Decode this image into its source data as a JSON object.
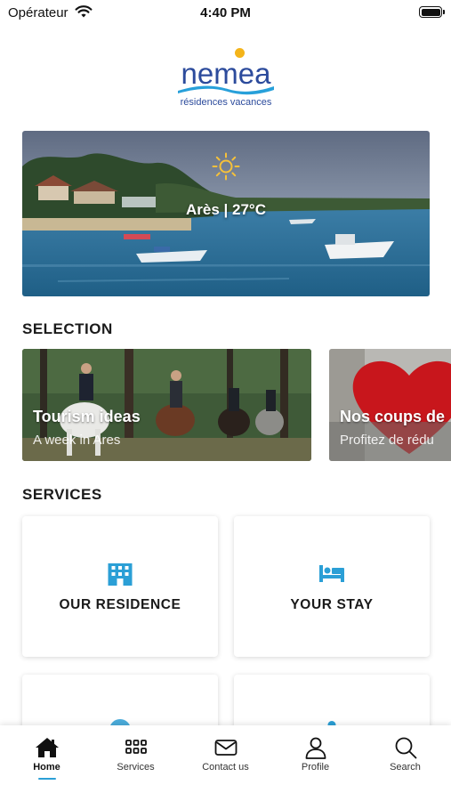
{
  "status_bar": {
    "carrier": "Opérateur",
    "time": "4:40 PM"
  },
  "logo": {
    "word": "nemea",
    "tagline": "résidences vacances"
  },
  "hero": {
    "weather_text": "Arès | 27°C",
    "weather_icon": "sun-icon"
  },
  "selection": {
    "title": "SELECTION",
    "cards": [
      {
        "title": "Tourism ideas",
        "subtitle": "A week in Ares"
      },
      {
        "title": "Nos coups de",
        "subtitle": "Profitez de rédu"
      }
    ]
  },
  "services": {
    "title": "SERVICES",
    "tiles": [
      {
        "label": "OUR RESIDENCE",
        "icon": "building-icon"
      },
      {
        "label": "YOUR STAY",
        "icon": "bed-icon"
      }
    ]
  },
  "tab_bar": {
    "items": [
      {
        "label": "Home",
        "icon": "home-icon",
        "active": true
      },
      {
        "label": "Services",
        "icon": "grid-icon"
      },
      {
        "label": "Contact us",
        "icon": "mail-icon"
      },
      {
        "label": "Profile",
        "icon": "user-icon"
      },
      {
        "label": "Search",
        "icon": "search-icon"
      }
    ]
  },
  "colors": {
    "accent": "#2b9fd6",
    "brand": "#2c4b9c",
    "logo_dot": "#f4b41a"
  }
}
